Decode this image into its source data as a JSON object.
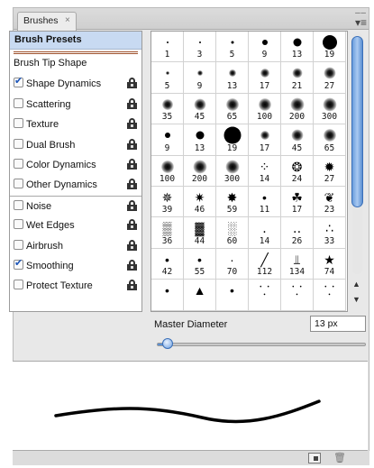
{
  "tab": {
    "title": "Brushes",
    "close_glyph": "×"
  },
  "options": {
    "header": "Brush Presets",
    "tip_shape": "Brush Tip Shape",
    "items": [
      {
        "label": "Shape Dynamics",
        "checked": true,
        "sep": false
      },
      {
        "label": "Scattering",
        "checked": false,
        "sep": false
      },
      {
        "label": "Texture",
        "checked": false,
        "sep": false
      },
      {
        "label": "Dual Brush",
        "checked": false,
        "sep": false
      },
      {
        "label": "Color Dynamics",
        "checked": false,
        "sep": false
      },
      {
        "label": "Other Dynamics",
        "checked": false,
        "sep": false
      },
      {
        "label": "Noise",
        "checked": false,
        "sep": true
      },
      {
        "label": "Wet Edges",
        "checked": false,
        "sep": false
      },
      {
        "label": "Airbrush",
        "checked": false,
        "sep": false
      },
      {
        "label": "Smoothing",
        "checked": true,
        "sep": false
      },
      {
        "label": "Protect Texture",
        "checked": false,
        "sep": false
      }
    ]
  },
  "brushes": [
    {
      "size": "1",
      "kind": "hard",
      "d": 2
    },
    {
      "size": "3",
      "kind": "hard",
      "d": 2
    },
    {
      "size": "5",
      "kind": "hard",
      "d": 3
    },
    {
      "size": "9",
      "kind": "hard",
      "d": 6
    },
    {
      "size": "13",
      "kind": "hard",
      "d": 9
    },
    {
      "size": "19",
      "kind": "hard",
      "d": 16
    },
    {
      "size": "5",
      "kind": "soft",
      "d": 4
    },
    {
      "size": "9",
      "kind": "soft",
      "d": 6
    },
    {
      "size": "13",
      "kind": "soft",
      "d": 8
    },
    {
      "size": "17",
      "kind": "soft",
      "d": 10
    },
    {
      "size": "21",
      "kind": "soft",
      "d": 11
    },
    {
      "size": "27",
      "kind": "soft",
      "d": 13
    },
    {
      "size": "35",
      "kind": "soft",
      "d": 12
    },
    {
      "size": "45",
      "kind": "soft",
      "d": 13
    },
    {
      "size": "65",
      "kind": "soft",
      "d": 14
    },
    {
      "size": "100",
      "kind": "soft",
      "d": 14
    },
    {
      "size": "200",
      "kind": "soft",
      "d": 15
    },
    {
      "size": "300",
      "kind": "soft",
      "d": 15
    },
    {
      "size": "9",
      "kind": "hard",
      "d": 6
    },
    {
      "size": "13",
      "kind": "hard",
      "d": 9
    },
    {
      "size": "19",
      "kind": "hard",
      "d": 19
    },
    {
      "size": "17",
      "kind": "soft",
      "d": 10
    },
    {
      "size": "45",
      "kind": "soft",
      "d": 13
    },
    {
      "size": "65",
      "kind": "soft",
      "d": 14
    },
    {
      "size": "100",
      "kind": "soft",
      "d": 14
    },
    {
      "size": "200",
      "kind": "soft",
      "d": 15
    },
    {
      "size": "300",
      "kind": "soft",
      "d": 15
    },
    {
      "size": "14",
      "kind": "shape",
      "glyph": "⁘"
    },
    {
      "size": "24",
      "kind": "shape",
      "glyph": "❂"
    },
    {
      "size": "27",
      "kind": "shape",
      "glyph": "✹"
    },
    {
      "size": "39",
      "kind": "shape",
      "glyph": "✵"
    },
    {
      "size": "46",
      "kind": "shape",
      "glyph": "✷"
    },
    {
      "size": "59",
      "kind": "shape",
      "glyph": "✸"
    },
    {
      "size": "11",
      "kind": "shape",
      "glyph": "•"
    },
    {
      "size": "17",
      "kind": "shape",
      "glyph": "☘"
    },
    {
      "size": "23",
      "kind": "shape",
      "glyph": "❦"
    },
    {
      "size": "36",
      "kind": "shape",
      "glyph": "▒"
    },
    {
      "size": "44",
      "kind": "shape",
      "glyph": "▓"
    },
    {
      "size": "60",
      "kind": "shape",
      "glyph": "░"
    },
    {
      "size": "14",
      "kind": "shape",
      "glyph": "․"
    },
    {
      "size": "26",
      "kind": "shape",
      "glyph": "‥"
    },
    {
      "size": "33",
      "kind": "shape",
      "glyph": "∴"
    },
    {
      "size": "42",
      "kind": "shape",
      "glyph": "•"
    },
    {
      "size": "55",
      "kind": "shape",
      "glyph": "•"
    },
    {
      "size": "70",
      "kind": "shape",
      "glyph": "·"
    },
    {
      "size": "112",
      "kind": "shape",
      "glyph": "╱"
    },
    {
      "size": "134",
      "kind": "shape",
      "glyph": "⫫"
    },
    {
      "size": "74",
      "kind": "shape",
      "glyph": "★"
    },
    {
      "size": "",
      "kind": "shape",
      "glyph": "•"
    },
    {
      "size": "",
      "kind": "shape",
      "glyph": "▲"
    },
    {
      "size": "",
      "kind": "shape",
      "glyph": "•"
    },
    {
      "size": "",
      "kind": "shape",
      "glyph": "⸪"
    },
    {
      "size": "",
      "kind": "shape",
      "glyph": "⸪"
    },
    {
      "size": "",
      "kind": "shape",
      "glyph": "⸪"
    }
  ],
  "master_diameter": {
    "label": "Master Diameter",
    "value": "13 px",
    "slider_fraction": 0.05
  },
  "colors": {
    "accent": "#5b8fd2",
    "header_bg": "#c8daf2"
  }
}
